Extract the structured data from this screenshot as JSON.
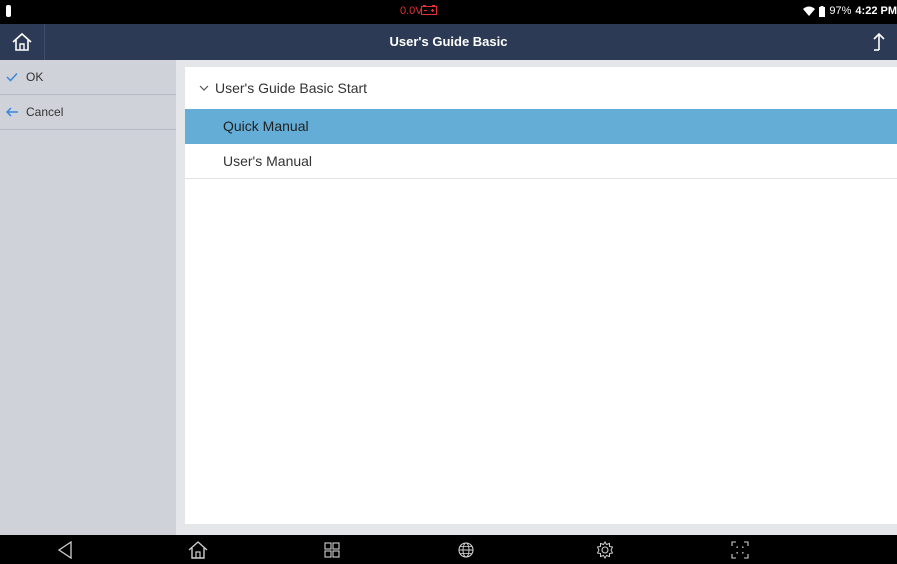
{
  "status_bar": {
    "voltage": "0.0V",
    "battery_percent": "97%",
    "time": "4:22 PM"
  },
  "title_bar": {
    "title": "User's Guide Basic"
  },
  "sidebar": {
    "items": [
      {
        "label": "OK",
        "icon": "check-icon"
      },
      {
        "label": "Cancel",
        "icon": "arrow-left-icon"
      }
    ]
  },
  "tree": {
    "header": "User's Guide Basic Start",
    "items": [
      {
        "label": "Quick Manual",
        "selected": true
      },
      {
        "label": "User's Manual",
        "selected": false
      }
    ]
  },
  "nav_bar": {
    "icons": [
      "back-icon",
      "home-icon",
      "apps-icon",
      "globe-icon",
      "settings-icon",
      "screenshot-icon"
    ]
  },
  "colors": {
    "title_bar": "#2c3a55",
    "sidebar": "#cfd2d8",
    "selected_row": "#64add6",
    "accent_icon": "#3a86d8",
    "voltage_text": "#e03030"
  }
}
